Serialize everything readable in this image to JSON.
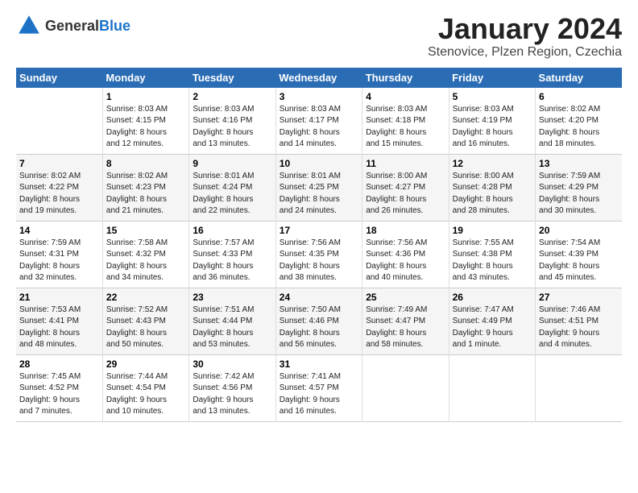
{
  "header": {
    "logo_general": "General",
    "logo_blue": "Blue",
    "title": "January 2024",
    "location": "Stenovice, Plzen Region, Czechia"
  },
  "weekdays": [
    "Sunday",
    "Monday",
    "Tuesday",
    "Wednesday",
    "Thursday",
    "Friday",
    "Saturday"
  ],
  "rows": [
    [
      {
        "day": "",
        "lines": []
      },
      {
        "day": "1",
        "lines": [
          "Sunrise: 8:03 AM",
          "Sunset: 4:15 PM",
          "Daylight: 8 hours",
          "and 12 minutes."
        ]
      },
      {
        "day": "2",
        "lines": [
          "Sunrise: 8:03 AM",
          "Sunset: 4:16 PM",
          "Daylight: 8 hours",
          "and 13 minutes."
        ]
      },
      {
        "day": "3",
        "lines": [
          "Sunrise: 8:03 AM",
          "Sunset: 4:17 PM",
          "Daylight: 8 hours",
          "and 14 minutes."
        ]
      },
      {
        "day": "4",
        "lines": [
          "Sunrise: 8:03 AM",
          "Sunset: 4:18 PM",
          "Daylight: 8 hours",
          "and 15 minutes."
        ]
      },
      {
        "day": "5",
        "lines": [
          "Sunrise: 8:03 AM",
          "Sunset: 4:19 PM",
          "Daylight: 8 hours",
          "and 16 minutes."
        ]
      },
      {
        "day": "6",
        "lines": [
          "Sunrise: 8:02 AM",
          "Sunset: 4:20 PM",
          "Daylight: 8 hours",
          "and 18 minutes."
        ]
      }
    ],
    [
      {
        "day": "7",
        "lines": [
          "Sunrise: 8:02 AM",
          "Sunset: 4:22 PM",
          "Daylight: 8 hours",
          "and 19 minutes."
        ]
      },
      {
        "day": "8",
        "lines": [
          "Sunrise: 8:02 AM",
          "Sunset: 4:23 PM",
          "Daylight: 8 hours",
          "and 21 minutes."
        ]
      },
      {
        "day": "9",
        "lines": [
          "Sunrise: 8:01 AM",
          "Sunset: 4:24 PM",
          "Daylight: 8 hours",
          "and 22 minutes."
        ]
      },
      {
        "day": "10",
        "lines": [
          "Sunrise: 8:01 AM",
          "Sunset: 4:25 PM",
          "Daylight: 8 hours",
          "and 24 minutes."
        ]
      },
      {
        "day": "11",
        "lines": [
          "Sunrise: 8:00 AM",
          "Sunset: 4:27 PM",
          "Daylight: 8 hours",
          "and 26 minutes."
        ]
      },
      {
        "day": "12",
        "lines": [
          "Sunrise: 8:00 AM",
          "Sunset: 4:28 PM",
          "Daylight: 8 hours",
          "and 28 minutes."
        ]
      },
      {
        "day": "13",
        "lines": [
          "Sunrise: 7:59 AM",
          "Sunset: 4:29 PM",
          "Daylight: 8 hours",
          "and 30 minutes."
        ]
      }
    ],
    [
      {
        "day": "14",
        "lines": [
          "Sunrise: 7:59 AM",
          "Sunset: 4:31 PM",
          "Daylight: 8 hours",
          "and 32 minutes."
        ]
      },
      {
        "day": "15",
        "lines": [
          "Sunrise: 7:58 AM",
          "Sunset: 4:32 PM",
          "Daylight: 8 hours",
          "and 34 minutes."
        ]
      },
      {
        "day": "16",
        "lines": [
          "Sunrise: 7:57 AM",
          "Sunset: 4:33 PM",
          "Daylight: 8 hours",
          "and 36 minutes."
        ]
      },
      {
        "day": "17",
        "lines": [
          "Sunrise: 7:56 AM",
          "Sunset: 4:35 PM",
          "Daylight: 8 hours",
          "and 38 minutes."
        ]
      },
      {
        "day": "18",
        "lines": [
          "Sunrise: 7:56 AM",
          "Sunset: 4:36 PM",
          "Daylight: 8 hours",
          "and 40 minutes."
        ]
      },
      {
        "day": "19",
        "lines": [
          "Sunrise: 7:55 AM",
          "Sunset: 4:38 PM",
          "Daylight: 8 hours",
          "and 43 minutes."
        ]
      },
      {
        "day": "20",
        "lines": [
          "Sunrise: 7:54 AM",
          "Sunset: 4:39 PM",
          "Daylight: 8 hours",
          "and 45 minutes."
        ]
      }
    ],
    [
      {
        "day": "21",
        "lines": [
          "Sunrise: 7:53 AM",
          "Sunset: 4:41 PM",
          "Daylight: 8 hours",
          "and 48 minutes."
        ]
      },
      {
        "day": "22",
        "lines": [
          "Sunrise: 7:52 AM",
          "Sunset: 4:43 PM",
          "Daylight: 8 hours",
          "and 50 minutes."
        ]
      },
      {
        "day": "23",
        "lines": [
          "Sunrise: 7:51 AM",
          "Sunset: 4:44 PM",
          "Daylight: 8 hours",
          "and 53 minutes."
        ]
      },
      {
        "day": "24",
        "lines": [
          "Sunrise: 7:50 AM",
          "Sunset: 4:46 PM",
          "Daylight: 8 hours",
          "and 56 minutes."
        ]
      },
      {
        "day": "25",
        "lines": [
          "Sunrise: 7:49 AM",
          "Sunset: 4:47 PM",
          "Daylight: 8 hours",
          "and 58 minutes."
        ]
      },
      {
        "day": "26",
        "lines": [
          "Sunrise: 7:47 AM",
          "Sunset: 4:49 PM",
          "Daylight: 9 hours",
          "and 1 minute."
        ]
      },
      {
        "day": "27",
        "lines": [
          "Sunrise: 7:46 AM",
          "Sunset: 4:51 PM",
          "Daylight: 9 hours",
          "and 4 minutes."
        ]
      }
    ],
    [
      {
        "day": "28",
        "lines": [
          "Sunrise: 7:45 AM",
          "Sunset: 4:52 PM",
          "Daylight: 9 hours",
          "and 7 minutes."
        ]
      },
      {
        "day": "29",
        "lines": [
          "Sunrise: 7:44 AM",
          "Sunset: 4:54 PM",
          "Daylight: 9 hours",
          "and 10 minutes."
        ]
      },
      {
        "day": "30",
        "lines": [
          "Sunrise: 7:42 AM",
          "Sunset: 4:56 PM",
          "Daylight: 9 hours",
          "and 13 minutes."
        ]
      },
      {
        "day": "31",
        "lines": [
          "Sunrise: 7:41 AM",
          "Sunset: 4:57 PM",
          "Daylight: 9 hours",
          "and 16 minutes."
        ]
      },
      {
        "day": "",
        "lines": []
      },
      {
        "day": "",
        "lines": []
      },
      {
        "day": "",
        "lines": []
      }
    ]
  ]
}
